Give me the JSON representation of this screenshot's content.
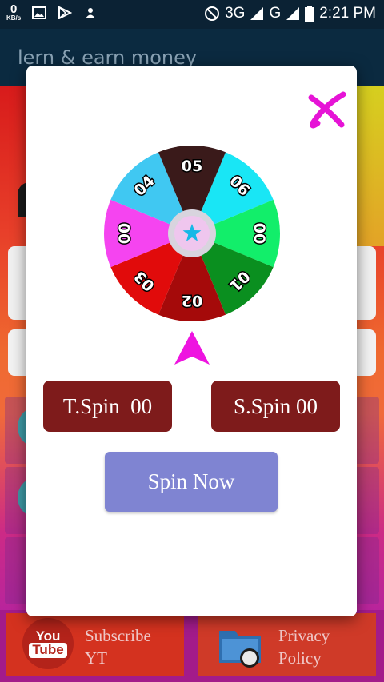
{
  "status_bar": {
    "speed_value": "0",
    "speed_unit": "KB/s",
    "network_1": "3G",
    "network_2": "G",
    "time": "2:21 PM",
    "icons": [
      "image-icon",
      "play-store-icon",
      "user-share-icon",
      "dnd-icon",
      "signal-icon",
      "signal-icon",
      "battery-icon"
    ]
  },
  "app_bar": {
    "title": "lern & earn money"
  },
  "dialog": {
    "wheel": {
      "segments": [
        {
          "label": "05",
          "color": "#3a1a1a"
        },
        {
          "label": "06",
          "color": "#19e6f5"
        },
        {
          "label": "00",
          "color": "#12ee6a"
        },
        {
          "label": "01",
          "color": "#0a8f1f"
        },
        {
          "label": "02",
          "color": "#a50a0a"
        },
        {
          "label": "03",
          "color": "#e10b0b"
        },
        {
          "label": "00",
          "color": "#f544f0"
        },
        {
          "label": "04",
          "color": "#40c8f2"
        }
      ],
      "center_icon": "star-icon"
    },
    "t_spin_label": "T.Spin  00",
    "s_spin_label": "S.Spin 00",
    "spin_button": "Spin Now",
    "close_icon": "close-icon"
  },
  "bottom": {
    "subscribe_line1": "Subscribe",
    "subscribe_line2": "YT",
    "yt_you": "You",
    "yt_tube": "Tube",
    "privacy_line1": "Privacy",
    "privacy_line2": "Policy"
  },
  "colors": {
    "status_bar": "#0b2234",
    "app_bar": "#0b2a40",
    "chip": "#7e1b1b",
    "spin_button": "#7f84d2",
    "close": "#e614d6",
    "pointer": "#ee14e0"
  }
}
